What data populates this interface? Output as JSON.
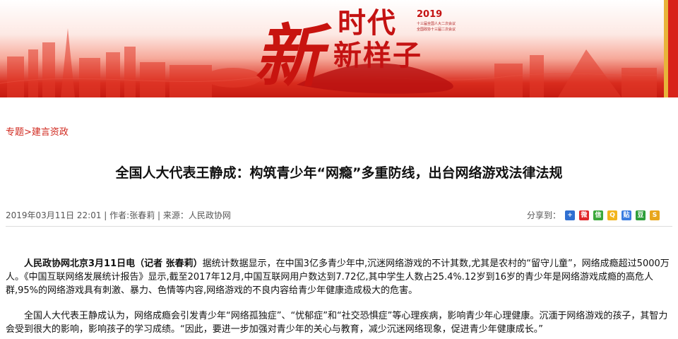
{
  "banner": {
    "char_big": "新",
    "title_line1": "时代",
    "title_line2": "新样子",
    "year": "2019",
    "sub_line1": "十三届全国人大二次会议",
    "sub_line2": "全国政协十三届二次会议"
  },
  "breadcrumb": {
    "topic": "专题",
    "separator": ">",
    "section": "建言资政"
  },
  "article": {
    "title": "全国人大代表王静成：构筑青少年“网瘾”多重防线，出台网络游戏法律法规",
    "meta_date": "2019年03月11日 22:01",
    "meta_author": "作者:张春莉",
    "meta_source": "来源：人民政协网",
    "lead_bold": "人民政协网北京3月11日电（记者 张春莉）",
    "p1_rest": "据统计数据显示，在中国3亿多青少年中,沉迷网络游戏的不计其数,尤其是农村的“留守儿童”，网络成瘾超过5000万人。《中国互联网络发展统计报告》显示,截至2017年12月,中国互联网用户数达到7.72亿,其中学生人数占25.4%.12岁到16岁的青少年是网络游戏成瘾的高危人群,95%的网络游戏具有刺激、暴力、色情等内容,网络游戏的不良内容给青少年健康造成极大的危害。",
    "p2": "全国人大代表王静成认为，网络成瘾会引发青少年“网络孤独症”、“忧郁症”和“社交恐惧症”等心理疾病，影响青少年心理健康。沉湎于网络游戏的孩子，其智力会受到很大的影响，影响孩子的学习成绩。“因此，要进一步加强对青少年的关心与教育，减少沉迷网络现象，促进青少年健康成长。”"
  },
  "share": {
    "label": "分享到：",
    "icons": [
      {
        "name": "plus-share-icon",
        "glyph": "+",
        "color": "#2f6fd1"
      },
      {
        "name": "weibo-icon",
        "glyph": "微",
        "color": "#e0262a"
      },
      {
        "name": "wechat-icon",
        "glyph": "信",
        "color": "#3aa83a"
      },
      {
        "name": "qzone-icon",
        "glyph": "Q",
        "color": "#f2b51d"
      },
      {
        "name": "tieba-icon",
        "glyph": "贴",
        "color": "#3b7de0"
      },
      {
        "name": "douban-icon",
        "glyph": "豆",
        "color": "#2f9e3a"
      },
      {
        "name": "sohu-icon",
        "glyph": "S",
        "color": "#e8a61c"
      }
    ]
  }
}
